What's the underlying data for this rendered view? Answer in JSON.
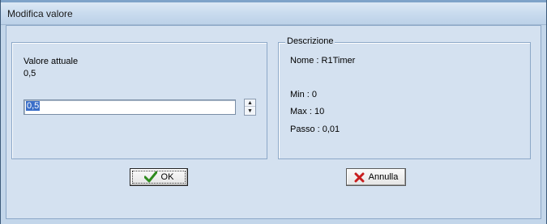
{
  "window": {
    "title": "Modifica valore"
  },
  "current": {
    "label": "Valore attuale",
    "value": "0,5"
  },
  "input": {
    "value": "0,5"
  },
  "spinner": {
    "up_icon": "spin-up-arrow",
    "down_icon": "spin-down-arrow"
  },
  "description": {
    "legend": "Descrizione",
    "name": "Nome : R1Timer",
    "min": "Min : 0",
    "max": "Max : 10",
    "step": "Passo : 0,01"
  },
  "buttons": {
    "ok": {
      "label": "OK",
      "icon": "check-icon"
    },
    "cancel": {
      "label": "Annulla",
      "icon": "x-icon"
    }
  },
  "colors": {
    "check": "#2e8b1e",
    "cross": "#c81e1e",
    "selection": "#3a6ec8"
  }
}
